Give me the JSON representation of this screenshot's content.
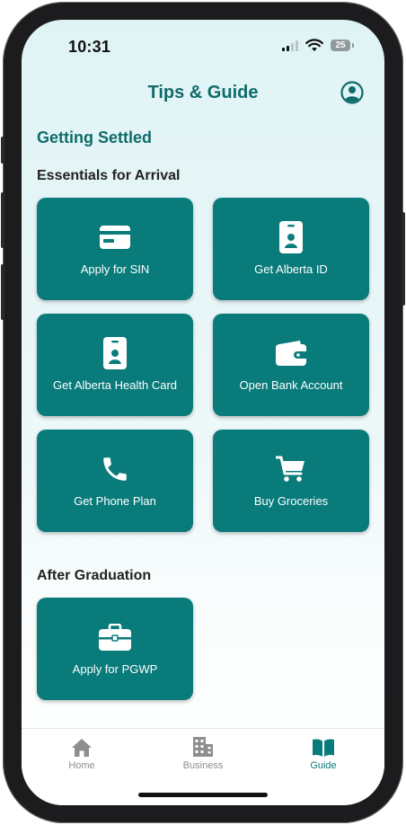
{
  "status": {
    "time": "10:31",
    "battery": "25"
  },
  "header": {
    "title": "Tips & Guide",
    "profile_icon": "person-circle-icon"
  },
  "page": {
    "section_title": "Getting Settled",
    "essentials_title": "Essentials for Arrival",
    "essentials": [
      {
        "label": "Apply for SIN",
        "icon": "credit-card-icon"
      },
      {
        "label": "Get Alberta ID",
        "icon": "id-badge-icon"
      },
      {
        "label": "Get Alberta Health Card",
        "icon": "id-badge-icon"
      },
      {
        "label": "Open Bank Account",
        "icon": "wallet-icon"
      },
      {
        "label": "Get Phone Plan",
        "icon": "phone-icon"
      },
      {
        "label": "Buy Groceries",
        "icon": "shopping-cart-icon"
      }
    ],
    "after_title": "After Graduation",
    "after": [
      {
        "label": "Apply for PGWP",
        "icon": "briefcase-icon"
      }
    ]
  },
  "tabs": [
    {
      "label": "Home",
      "icon": "home-icon",
      "active": false
    },
    {
      "label": "Business",
      "icon": "building-icon",
      "active": false
    },
    {
      "label": "Guide",
      "icon": "book-open-icon",
      "active": true
    }
  ],
  "colors": {
    "accent": "#0a7b7b",
    "title": "#106b6b",
    "inactive_tab": "#8e8e8e"
  }
}
